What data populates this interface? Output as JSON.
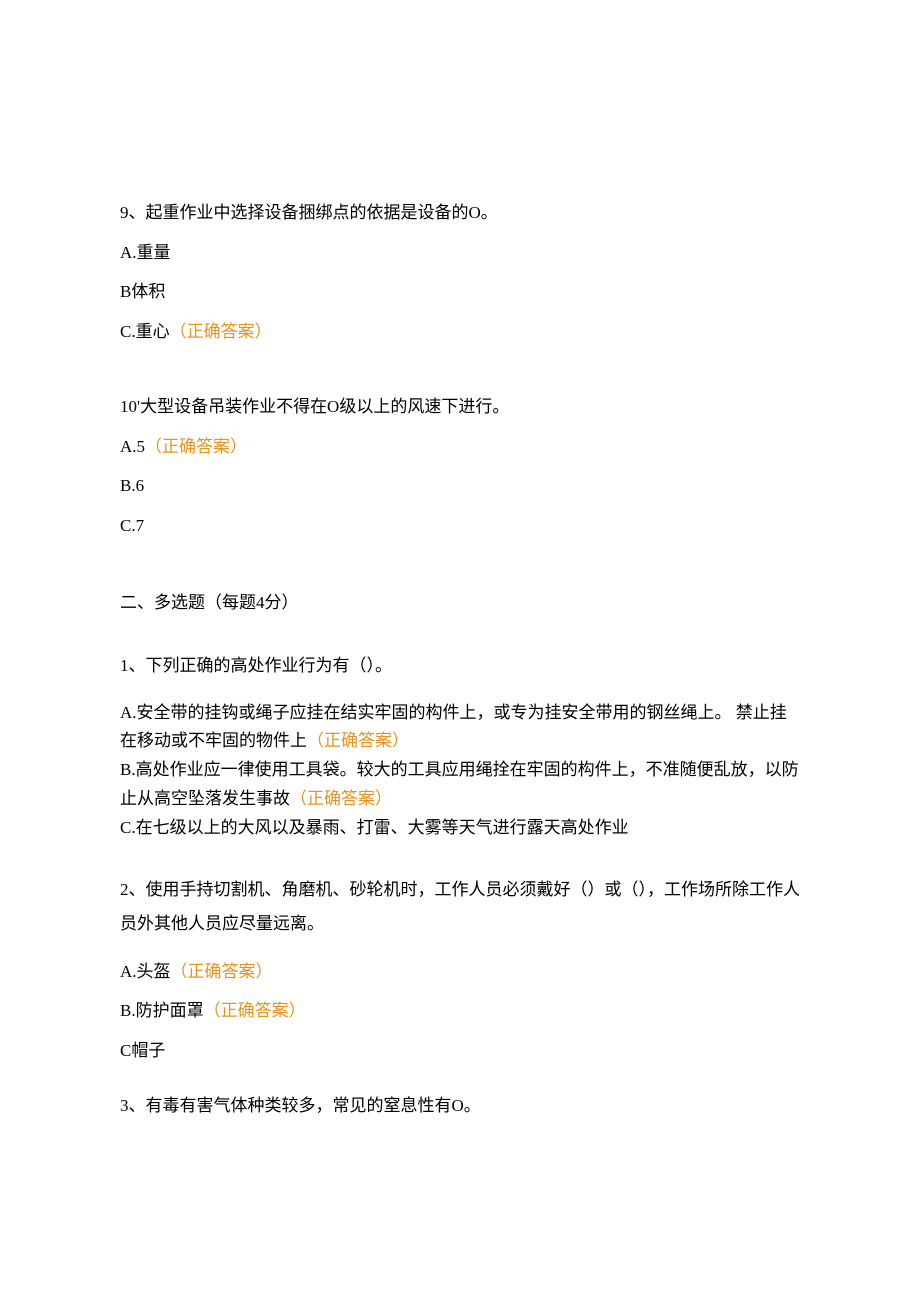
{
  "q9": {
    "stem": "9、起重作业中选择设备捆绑点的依据是设备的O。",
    "a": "A.重量",
    "b": "B体积",
    "c_pre": "C.重心",
    "c_mark": "（正确答案）"
  },
  "q10": {
    "stem": "10'大型设备吊装作业不得在O级以上的风速下进行。",
    "a_pre": "A.5",
    "a_mark": "（正确答案）",
    "b": "B.6",
    "c": "C.7"
  },
  "sec2": "二、多选题（每题4分）",
  "mq1": {
    "stem": "1、下列正确的高处作业行为有（）。",
    "a_pre": "A.安全带的挂钩或绳子应挂在结实牢固的构件上，或专为挂安全带用的钢丝绳上。 禁止挂在移动或不牢固的物件上",
    "a_mark": "（正确答案）",
    "b_pre": "B.高处作业应一律使用工具袋。较大的工具应用绳拴在牢固的构件上，不准随便乱放，以防止从高空坠落发生事故",
    "b_mark": "（正确答案）",
    "c": "C.在七级以上的大风以及暴雨、打雷、大雾等天气进行露天高处作业"
  },
  "mq2": {
    "stem": "2、使用手持切割机、角磨机、砂轮机时，工作人员必须戴好（）或（），工作场所除工作人员外其他人员应尽量远离。",
    "a_pre": "A.头盔",
    "a_mark": "（正确答案）",
    "b_pre": "B.防护面罩",
    "b_mark": "（正确答案）",
    "c": "C帽子"
  },
  "mq3": {
    "stem": "3、有毒有害气体种类较多，常见的窒息性有O。"
  }
}
